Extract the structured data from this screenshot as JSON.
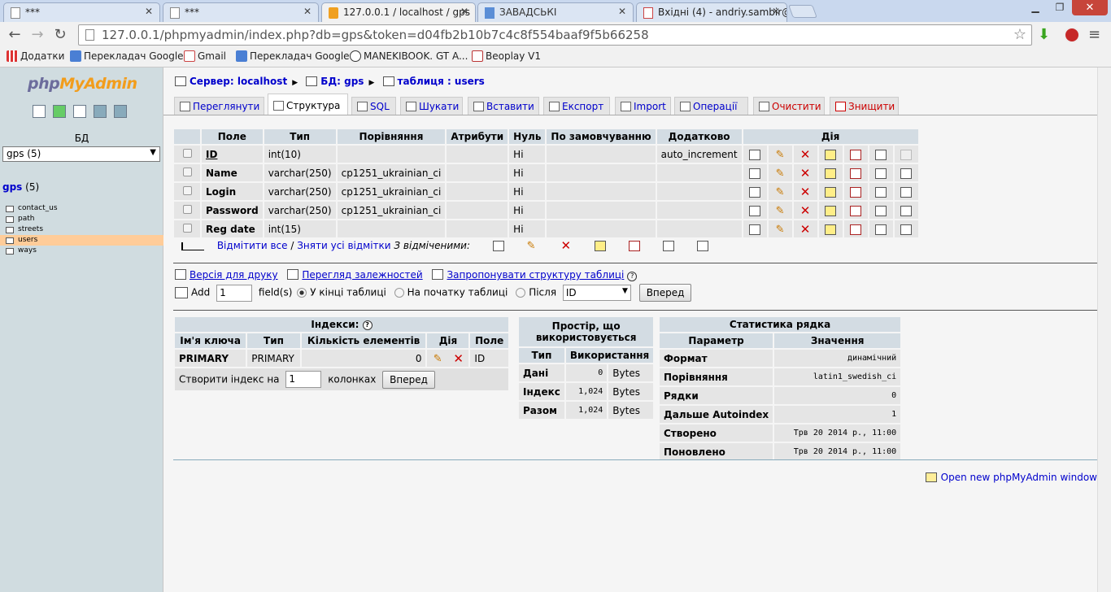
{
  "browser": {
    "tabs": [
      {
        "title": "***",
        "icon": "page-icon"
      },
      {
        "title": "***",
        "icon": "page-icon"
      },
      {
        "title": "127.0.0.1 / localhost / gps",
        "icon": "pma-icon"
      },
      {
        "title": "ЗАВАДСЬКІ",
        "icon": "doc-icon"
      },
      {
        "title": "Вхідні (4) - andriy.sambir@",
        "icon": "gmail-icon"
      }
    ],
    "url": "127.0.0.1/phpmyadmin/index.php?db=gps&token=d04fb2b10b7c4c8f554baaf9f5b66258",
    "bookmarks": [
      "Додатки",
      "Перекладач Google",
      "Gmail",
      "Перекладач Google",
      "MANEKIBOOK. GT A...",
      "Beoplay V1"
    ]
  },
  "left": {
    "logo_a": "php",
    "logo_b": "MyAdmin",
    "db_label": "БД",
    "db_select": "gps (5)",
    "db_name": "gps",
    "db_count": "(5)",
    "tables": [
      "contact_us",
      "path",
      "streets",
      "users",
      "ways"
    ],
    "selected_table": "users"
  },
  "breadcrumb": {
    "server": "Сервер: localhost",
    "db": "БД: gps",
    "table": "таблиця : users"
  },
  "tabs": [
    "Переглянути",
    "Структура",
    "SQL",
    "Шукати",
    "Вставити",
    "Експорт",
    "Import",
    "Операції",
    "Очистити",
    "Знищити"
  ],
  "structure": {
    "headers": [
      "Поле",
      "Тип",
      "Порівняння",
      "Атрибути",
      "Нуль",
      "По замовчуванню",
      "Додатково",
      "Дія"
    ],
    "rows": [
      {
        "field": "ID",
        "type": "int(10)",
        "collation": "",
        "attributes": "",
        "null": "Ні",
        "default": "",
        "extra": "auto_increment"
      },
      {
        "field": "Name",
        "type": "varchar(250)",
        "collation": "cp1251_ukrainian_ci",
        "attributes": "",
        "null": "Ні",
        "default": "",
        "extra": ""
      },
      {
        "field": "Login",
        "type": "varchar(250)",
        "collation": "cp1251_ukrainian_ci",
        "attributes": "",
        "null": "Ні",
        "default": "",
        "extra": ""
      },
      {
        "field": "Password",
        "type": "varchar(250)",
        "collation": "cp1251_ukrainian_ci",
        "attributes": "",
        "null": "Ні",
        "default": "",
        "extra": ""
      },
      {
        "field": "Reg date",
        "type": "int(15)",
        "collation": "",
        "attributes": "",
        "null": "Ні",
        "default": "",
        "extra": ""
      }
    ],
    "check_all": "Відмітити все",
    "slash": "/",
    "uncheck_all": "Зняти усі відмітки",
    "with_selected": "З відміченими:"
  },
  "actions": {
    "print_view": "Версія для друку",
    "relation_view": "Перегляд залежностей",
    "propose": "Запропонувати структуру таблиці",
    "add_label": "Add",
    "add_value": "1",
    "fields_label": "field(s)",
    "at_end": "У кінці таблиці",
    "at_begin": "На початку таблиці",
    "after": "Після",
    "after_field": "ID",
    "go": "Вперед"
  },
  "indexes": {
    "title": "Індекси:",
    "headers": [
      "Ім'я ключа",
      "Тип",
      "Кількість елементів",
      "Дія",
      "Поле"
    ],
    "row": {
      "name": "PRIMARY",
      "type": "PRIMARY",
      "cardinality": "0",
      "field": "ID"
    },
    "create_label": "Створити індекс на",
    "create_value": "1",
    "columns_label": "колонках",
    "go": "Вперед"
  },
  "space": {
    "title": "Простір, що використовується",
    "headers": [
      "Тип",
      "Використання"
    ],
    "rows": [
      {
        "type": "Дані",
        "value": "0",
        "unit": "Bytes"
      },
      {
        "type": "Індекс",
        "value": "1,024",
        "unit": "Bytes"
      },
      {
        "type": "Разом",
        "value": "1,024",
        "unit": "Bytes"
      }
    ]
  },
  "stats": {
    "title": "Статистика рядка",
    "headers": [
      "Параметр",
      "Значення"
    ],
    "rows": [
      {
        "param": "Формат",
        "value": "динамічний"
      },
      {
        "param": "Порівняння",
        "value": "latin1_swedish_ci"
      },
      {
        "param": "Рядки",
        "value": "0"
      },
      {
        "param": "Дальше Autoindex",
        "value": "1"
      },
      {
        "param": "Створено",
        "value": "Трв 20 2014 р., 11:00"
      },
      {
        "param": "Поновлено",
        "value": "Трв 20 2014 р., 11:00"
      }
    ]
  },
  "open_window": "Open new phpMyAdmin window",
  "colors": {
    "link": "#0000cc",
    "header_bg": "#d3dce3",
    "row_bg": "#e5e5e5",
    "sidebar_bg": "#d0dce0",
    "selected_table": "#ffcc99"
  }
}
